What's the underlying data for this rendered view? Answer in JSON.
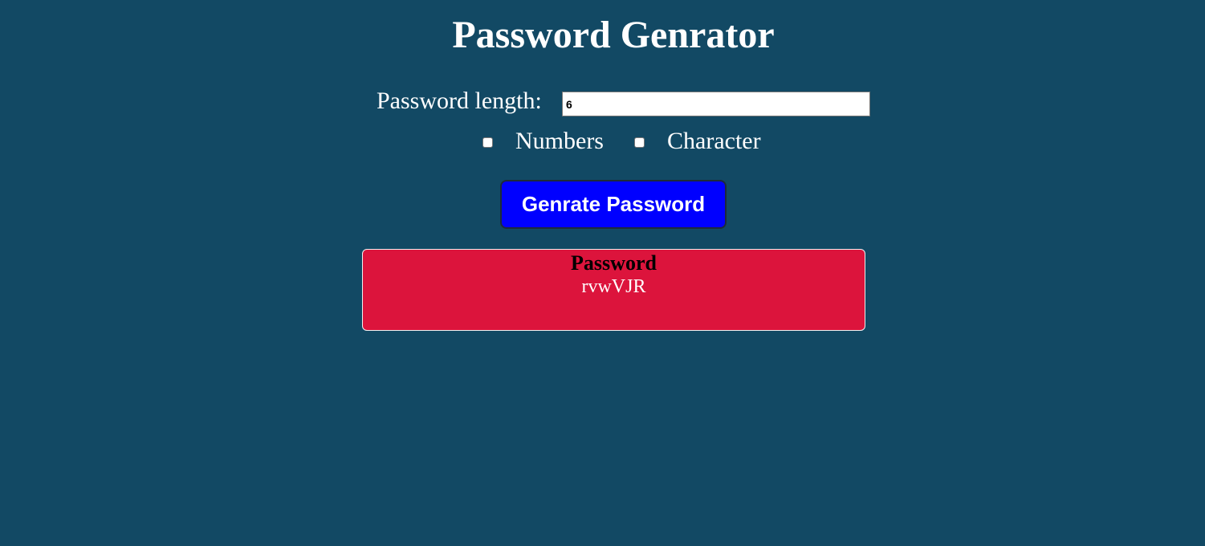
{
  "page": {
    "title": "Password Genrator"
  },
  "form": {
    "length_label": "Password length:",
    "length_value": "6",
    "numbers_label": "Numbers",
    "numbers_checked": false,
    "character_label": "Character",
    "character_checked": false,
    "generate_label": "Genrate Password"
  },
  "result": {
    "heading": "Password",
    "value": "rvwVJR"
  },
  "colors": {
    "background": "#124964",
    "button": "#0000ff",
    "result_box": "#dc143c"
  }
}
